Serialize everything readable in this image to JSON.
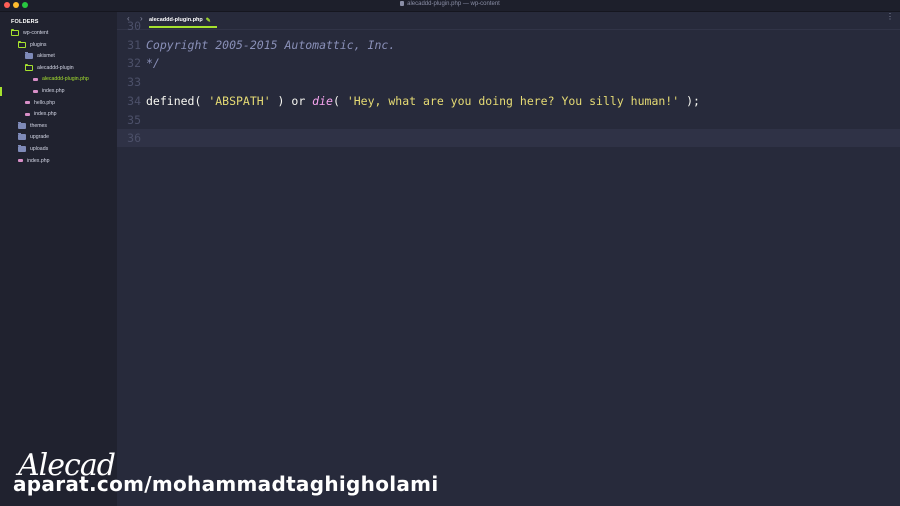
{
  "window": {
    "title": "alecaddd-plugin.php — wp-content",
    "colors": {
      "close": "#ff5f57",
      "minimize": "#febc2e",
      "maximize": "#28c840"
    }
  },
  "sidebar": {
    "heading": "FOLDERS",
    "tree": [
      {
        "label": "wp-content",
        "type": "folder-open",
        "depth": 0
      },
      {
        "label": "plugins",
        "type": "folder-open",
        "depth": 1
      },
      {
        "label": "akismet",
        "type": "folder-closed",
        "depth": 2
      },
      {
        "label": "alecaddd-plugin",
        "type": "folder-open",
        "depth": 2
      },
      {
        "label": "alecaddd-plugin.php",
        "type": "php-file",
        "depth": 3,
        "active": true
      },
      {
        "label": "index.php",
        "type": "php-file",
        "depth": 3
      },
      {
        "label": "hello.php",
        "type": "php-file",
        "depth": 2
      },
      {
        "label": "index.php",
        "type": "php-file",
        "depth": 2
      },
      {
        "label": "themes",
        "type": "folder-closed",
        "depth": 1
      },
      {
        "label": "upgrade",
        "type": "folder-closed",
        "depth": 1
      },
      {
        "label": "uploads",
        "type": "folder-closed",
        "depth": 1
      },
      {
        "label": "index.php",
        "type": "php-file",
        "depth": 1
      }
    ]
  },
  "tabs": {
    "back": "‹",
    "forward": "›",
    "active_tab": "alecaddd-plugin.php",
    "modified_icon": "✎",
    "more": "⋮"
  },
  "editor": {
    "lines": [
      {
        "number": "30",
        "segments": []
      },
      {
        "number": "31",
        "segments": [
          {
            "text": "Copyright 2005-2015 Automattic, Inc.",
            "cls": "comment"
          }
        ]
      },
      {
        "number": "32",
        "segments": [
          {
            "text": "*/",
            "cls": "comment"
          }
        ]
      },
      {
        "number": "33",
        "segments": []
      },
      {
        "number": "34",
        "segments": [
          {
            "text": "defined( ",
            "cls": "plain"
          },
          {
            "text": "'ABSPATH'",
            "cls": "str"
          },
          {
            "text": " ) or ",
            "cls": "plain"
          },
          {
            "text": "die",
            "cls": "fn-italic"
          },
          {
            "text": "( ",
            "cls": "plain"
          },
          {
            "text": "'Hey, what are you doing here? You silly human!'",
            "cls": "str"
          },
          {
            "text": " );",
            "cls": "plain"
          }
        ]
      },
      {
        "number": "35",
        "segments": []
      },
      {
        "number": "36",
        "segments": [],
        "current": true
      }
    ]
  },
  "watermark": {
    "signature": "Alecad",
    "site": "aparat.com/mohammadtaghigholami"
  }
}
